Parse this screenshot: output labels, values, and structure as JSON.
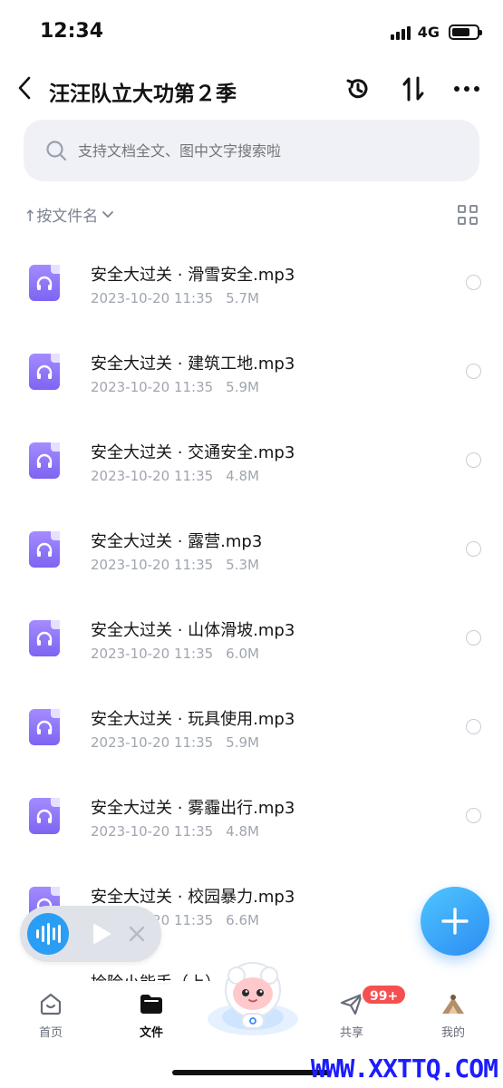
{
  "status_bar": {
    "time": "12:34",
    "network": "4G"
  },
  "header": {
    "title": "汪汪队立大功第２季"
  },
  "search": {
    "placeholder": "支持文档全文、图中文字搜索啦"
  },
  "sort": {
    "label": "↑按文件名"
  },
  "files": [
    {
      "name": "安全大过关 · 滑雪安全.mp3",
      "date": "2023-10-20 11:35",
      "size": "5.7M"
    },
    {
      "name": "安全大过关 · 建筑工地.mp3",
      "date": "2023-10-20 11:35",
      "size": "5.9M"
    },
    {
      "name": "安全大过关 · 交通安全.mp3",
      "date": "2023-10-20 11:35",
      "size": "4.8M"
    },
    {
      "name": "安全大过关 · 露营.mp3",
      "date": "2023-10-20 11:35",
      "size": "5.3M"
    },
    {
      "name": "安全大过关 · 山体滑坡.mp3",
      "date": "2023-10-20 11:35",
      "size": "6.0M"
    },
    {
      "name": "安全大过关 · 玩具使用.mp3",
      "date": "2023-10-20 11:35",
      "size": "5.9M"
    },
    {
      "name": "安全大过关 · 雾霾出行.mp3",
      "date": "2023-10-20 11:35",
      "size": "4.8M"
    },
    {
      "name": "安全大过关 · 校园暴力.mp3",
      "date": "2023-10-20 11:35",
      "size": "6.6M"
    }
  ],
  "partial_row": {
    "name": "捡险小能手（上）"
  },
  "tabs": [
    {
      "label": "首页",
      "icon": "home-icon"
    },
    {
      "label": "文件",
      "icon": "folder-icon"
    },
    {
      "label": "共享",
      "icon": "send-icon"
    },
    {
      "label": "我的",
      "icon": "avatar"
    }
  ],
  "share_badge": "99+",
  "watermark": "WWW.XXTTQ.COM",
  "colors": {
    "accent": "#2c8cf2",
    "file_icon": "#8c74f8",
    "badge": "#f5504f"
  }
}
